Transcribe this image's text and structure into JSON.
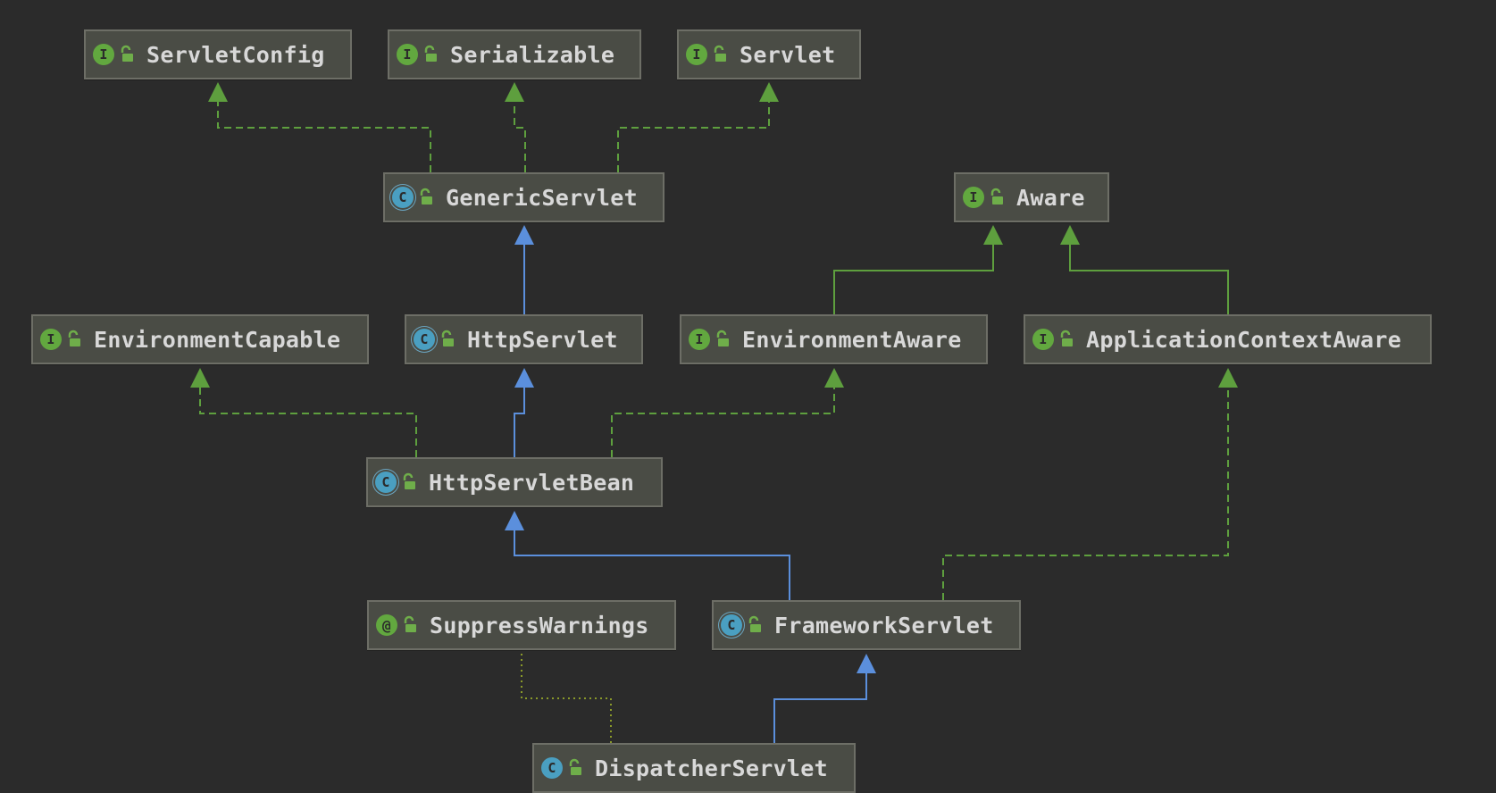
{
  "colors": {
    "background": "#2b2b2b",
    "node_fill": "#4a4c45",
    "node_border": "#6d6e66",
    "text": "#d8d8d8",
    "implements_edge": "#5e9f3e",
    "extends_edge": "#5b8fdc",
    "interface_icon": "#62a83f",
    "class_icon": "#4a9fc1"
  },
  "legend_note": "",
  "nodes": {
    "servlet_config": {
      "label": "ServletConfig",
      "kind": "interface",
      "badge": "I",
      "icon": "interface-icon"
    },
    "serializable": {
      "label": "Serializable",
      "kind": "interface",
      "badge": "I",
      "icon": "interface-icon"
    },
    "servlet": {
      "label": "Servlet",
      "kind": "interface",
      "badge": "I",
      "icon": "interface-icon"
    },
    "generic_servlet": {
      "label": "GenericServlet",
      "kind": "abstract-class",
      "badge": "C",
      "icon": "abstract-class-icon"
    },
    "aware": {
      "label": "Aware",
      "kind": "interface",
      "badge": "I",
      "icon": "interface-icon"
    },
    "environment_capable": {
      "label": "EnvironmentCapable",
      "kind": "interface",
      "badge": "I",
      "icon": "interface-icon"
    },
    "http_servlet": {
      "label": "HttpServlet",
      "kind": "abstract-class",
      "badge": "C",
      "icon": "abstract-class-icon"
    },
    "environment_aware": {
      "label": "EnvironmentAware",
      "kind": "interface",
      "badge": "I",
      "icon": "interface-icon"
    },
    "application_context_aware": {
      "label": "ApplicationContextAware",
      "kind": "interface",
      "badge": "I",
      "icon": "interface-icon"
    },
    "http_servlet_bean": {
      "label": "HttpServletBean",
      "kind": "abstract-class",
      "badge": "C",
      "icon": "abstract-class-icon"
    },
    "suppress_warnings": {
      "label": "SuppressWarnings",
      "kind": "annotation",
      "badge": "@",
      "icon": "annotation-icon"
    },
    "framework_servlet": {
      "label": "FrameworkServlet",
      "kind": "abstract-class",
      "badge": "C",
      "icon": "abstract-class-icon"
    },
    "dispatcher_servlet": {
      "label": "DispatcherServlet",
      "kind": "class",
      "badge": "C",
      "icon": "class-icon"
    }
  },
  "edges": [
    {
      "from": "generic_servlet",
      "to": "servlet_config",
      "type": "implements"
    },
    {
      "from": "generic_servlet",
      "to": "serializable",
      "type": "implements"
    },
    {
      "from": "generic_servlet",
      "to": "servlet",
      "type": "implements"
    },
    {
      "from": "http_servlet",
      "to": "generic_servlet",
      "type": "extends"
    },
    {
      "from": "environment_aware",
      "to": "aware",
      "type": "extends-interface"
    },
    {
      "from": "application_context_aware",
      "to": "aware",
      "type": "extends-interface"
    },
    {
      "from": "http_servlet_bean",
      "to": "http_servlet",
      "type": "extends"
    },
    {
      "from": "http_servlet_bean",
      "to": "environment_capable",
      "type": "implements"
    },
    {
      "from": "http_servlet_bean",
      "to": "environment_aware",
      "type": "implements"
    },
    {
      "from": "framework_servlet",
      "to": "http_servlet_bean",
      "type": "extends"
    },
    {
      "from": "framework_servlet",
      "to": "application_context_aware",
      "type": "implements"
    },
    {
      "from": "dispatcher_servlet",
      "to": "framework_servlet",
      "type": "extends"
    },
    {
      "from": "dispatcher_servlet",
      "to": "suppress_warnings",
      "type": "annotated-with"
    }
  ]
}
